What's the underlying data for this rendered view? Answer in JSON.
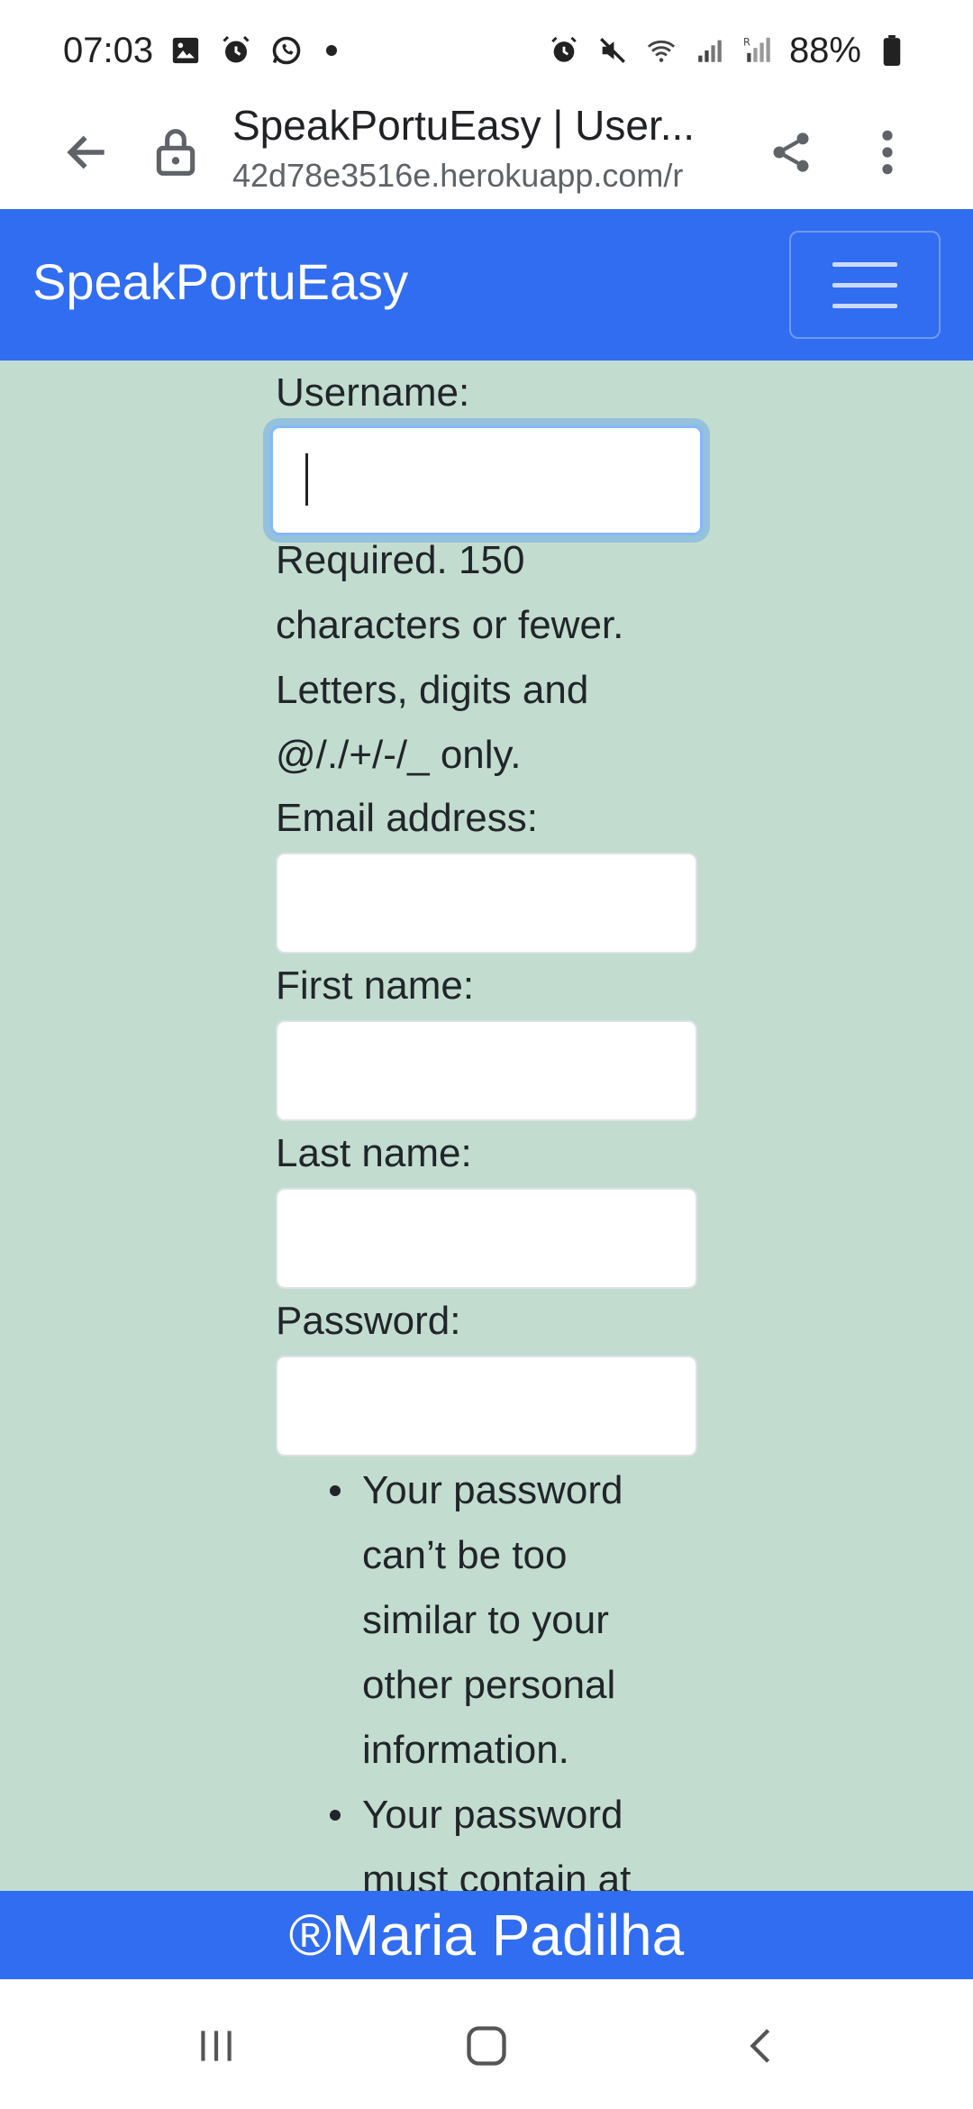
{
  "status_bar": {
    "time": "07:03",
    "battery": "88%"
  },
  "browser": {
    "page_title": "SpeakPortuEasy | User...",
    "url": "42d78e3516e.herokuapp.com/r"
  },
  "navbar": {
    "brand": "SpeakPortuEasy"
  },
  "form": {
    "username_label": "Username:",
    "username_value": "",
    "username_help": "Required. 150 characters or fewer. Letters, digits and @/./+/-/_ only.",
    "email_label": "Email address:",
    "email_value": "",
    "first_name_label": "First name:",
    "first_name_value": "",
    "last_name_label": "Last name:",
    "last_name_value": "",
    "password_label": "Password:",
    "password_value": "",
    "password_rules": [
      "Your password can’t be too similar to your other personal information.",
      "Your password must contain at"
    ]
  },
  "footer": {
    "text": "®Maria Padilha"
  },
  "colors": {
    "navbar": "#316df0",
    "content_bg": "#c2dcd0",
    "footer": "#316df0"
  }
}
